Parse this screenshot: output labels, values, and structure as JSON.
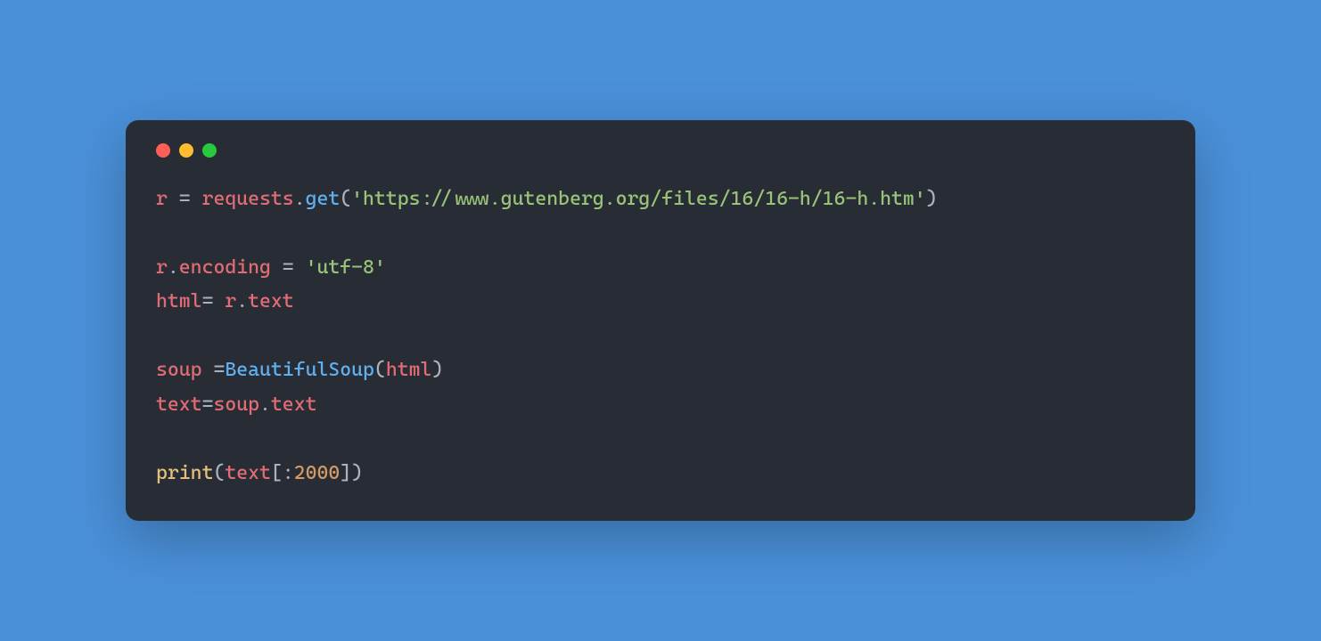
{
  "window": {
    "traffic_lights": [
      "close",
      "minimize",
      "zoom"
    ]
  },
  "code": {
    "line1": {
      "var_r": "r",
      "assign": " = ",
      "obj_requests": "requests",
      "dot1": ".",
      "fn_get": "get",
      "lparen": "(",
      "url": "'https://www.gutenberg.org/files/16/16-h/16-h.htm'",
      "rparen": ")"
    },
    "line3": {
      "var_r": "r",
      "dot": ".",
      "attr_encoding": "encoding",
      "assign": " = ",
      "val": "'utf-8'"
    },
    "line4": {
      "var_html": "html",
      "assign": "= ",
      "var_r": "r",
      "dot": ".",
      "attr_text": "text"
    },
    "line6": {
      "var_soup": "soup",
      "assign": " =",
      "cls_bs": "BeautifulSoup",
      "lparen": "(",
      "arg_html": "html",
      "rparen": ")"
    },
    "line7": {
      "var_text": "text",
      "assign": "=",
      "var_soup": "soup",
      "dot": ".",
      "attr_text": "text"
    },
    "line9": {
      "fn_print": "print",
      "lparen": "(",
      "var_text": "text",
      "lbrack": "[",
      "colon": ":",
      "num": "2000",
      "rbrack": "]",
      "rparen": ")"
    }
  }
}
